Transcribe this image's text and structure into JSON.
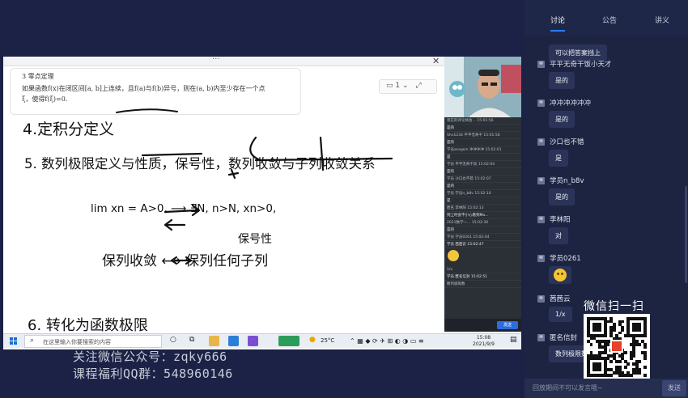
{
  "tabs": [
    {
      "label": "讨论",
      "active": true
    },
    {
      "label": "公告",
      "active": false
    },
    {
      "label": "讲义",
      "active": false
    }
  ],
  "messages": [
    {
      "name": "",
      "text": "可以把答案挡上",
      "emoji": false
    },
    {
      "name": "平平无奇干饭小天才",
      "text": "是的",
      "emoji": false
    },
    {
      "name": "冲冲冲冲冲冲",
      "text": "是的",
      "emoji": false
    },
    {
      "name": "沙口也不错",
      "text": "是",
      "emoji": false
    },
    {
      "name": "学员n_b8v",
      "text": "是的",
      "emoji": false
    },
    {
      "name": "李林阳",
      "text": "对",
      "emoji": false
    },
    {
      "name": "学员0261",
      "text": "",
      "emoji": true
    },
    {
      "name": "茜茜云",
      "text": "1/x",
      "emoji": false
    },
    {
      "name": "匿名信封",
      "text": "数列极限数",
      "emoji": false
    }
  ],
  "chat_input": {
    "placeholder": "回放期间不可以发言哦~",
    "send_label": "发送"
  },
  "qr": {
    "title": "微信扫一扫"
  },
  "watermark": {
    "line1": "关注微信公众号：zqky666",
    "line2": "课程福利QQ群：548960146"
  },
  "theorem": {
    "title": "3 零点定理",
    "line1": "如果函数f(x)在闭区间[a, b]上连续，且f(a)与f(b)异号，则在(a, b)内至少存在一个点",
    "line2": "ξ，使得f(ξ)=0."
  },
  "page_ctrl": {
    "page": "1"
  },
  "handwriting": {
    "line4": "4.定积分定义",
    "line5": "5. 数列极限定义与性质，保号性，数列收敛与子列收敛关系",
    "limit": "lim xn = A>0,  ⟶ ∃N, n>N, xn>0,",
    "note": "保号性",
    "converge": "保列收敛 ⟷ 保列任何子列",
    "line6": "6. 转化为函数极限"
  },
  "taskbar": {
    "search_placeholder": "在这里输入你要搜索的内容",
    "temperature": "25°C",
    "time": "15:08",
    "date": "2021/9/9"
  },
  "mini_chat_lines": [
    "现在的评论将会… 15:01:56",
    "是的",
    "Shn1234 平平无奇干 15:01:58",
    "是的",
    "学员ansgsm 冲冲冲冲 15:02:01",
    "是",
    "学员 平平无奇干饭 15:02:04",
    "是的",
    "学员 沙口也不错 15:02:07",
    "是的",
    "学员 学员n_b8v 15:02:10",
    "是",
    "匿名 李林阳 15:02:13",
    "到上时会不小心看到Mo…",
    "2021数学一… 15:02:30",
    "是的",
    "学员 学员0261 15:02:44",
    "学员 茜茜云 15:02:47",
    "1/x",
    "学员 匿名信封 15:02:51",
    "数列极限数"
  ],
  "mini_chat_send": "发送"
}
